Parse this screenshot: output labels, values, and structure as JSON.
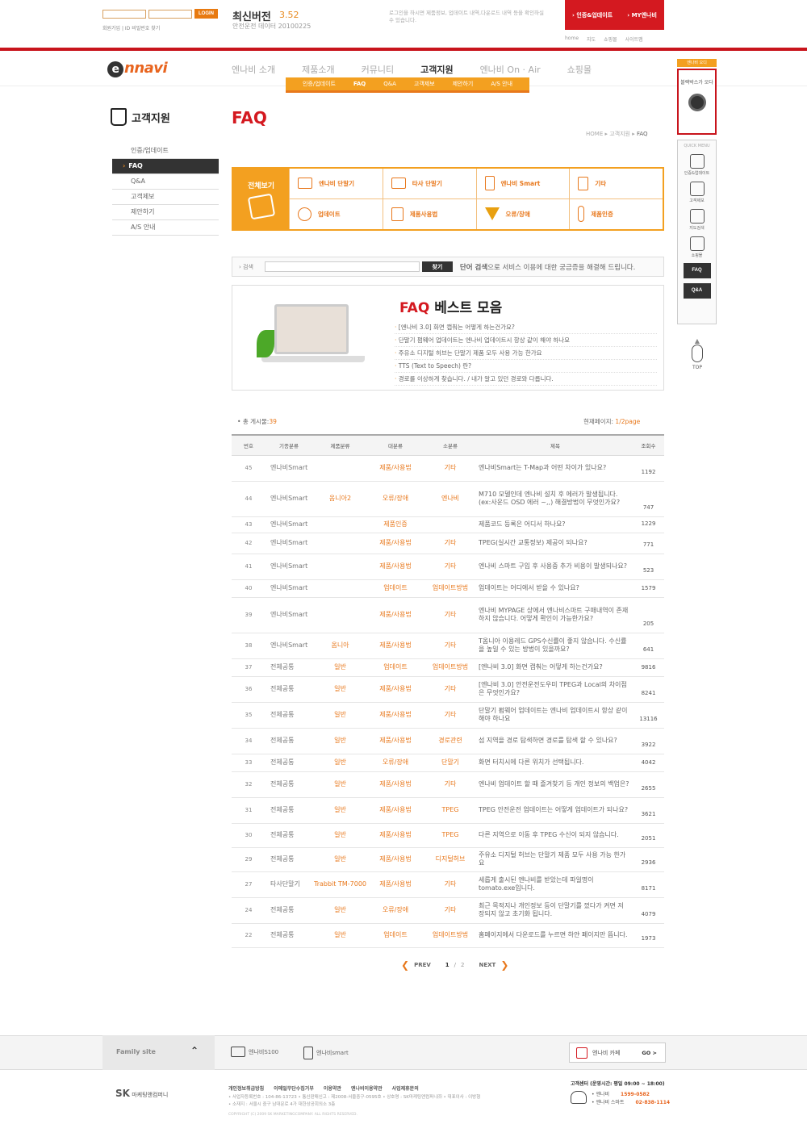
{
  "top": {
    "login_label": "LOGIN",
    "links": "회원가입 | ID 비밀번호 찾기",
    "version_title": "최신버전",
    "version_num": "3.52",
    "version_sub": "안전운전 데이터  20100225",
    "notice": "로그인을 하시면 제품정보, 업데이트 내역,다운로드 내역 등을 확인하실 수 있습니다.",
    "red_links": [
      "인증&업데이트",
      "MY엔나비"
    ],
    "util_links": [
      "home",
      "지도",
      "쇼핑몰",
      "사이트맵"
    ]
  },
  "gnb": {
    "logo_o": "e",
    "logo_text": "nnavi",
    "items": [
      "엔나비 소개",
      "제품소개",
      "커뮤니티",
      "고객지원",
      "엔나비 On · Air",
      "쇼핑몰"
    ],
    "sub": [
      "인증/업데이트",
      "FAQ",
      "Q&A",
      "고객제보",
      "제안하기",
      "A/S 안내"
    ]
  },
  "lnb": {
    "title": "고객지원",
    "items": [
      "인증/업데이트",
      "FAQ",
      "Q&A",
      "고객제보",
      "제안하기",
      "A/S 안내"
    ]
  },
  "page": {
    "title": "FAQ",
    "breadcrumb": [
      "HOME",
      "고객지원",
      "FAQ"
    ]
  },
  "categories": {
    "all": "전체보기",
    "items": [
      "엔나비 단말기",
      "타사 단말기",
      "엔나비 Smart",
      "기타",
      "업데이트",
      "제품사용법",
      "오류/장애",
      "제품인증"
    ]
  },
  "search": {
    "label": "검색",
    "button": "찾기",
    "desc_bold": "단어 검색",
    "desc": "으로 서비스 이용에 대한 궁금증을 해결해 드립니다."
  },
  "best": {
    "title_red": "FAQ",
    "title": " 베스트 모음",
    "items": [
      "[엔나비 3.0] 화면 캡춰는 어떻게 하는건가요?",
      "단말기 펌웨어 업데이트는 엔나비 업데이트시 항상 같이 해야 하나요",
      "주유소 디지털 허브는 단말기 제품 모두 사용 가능 한가요",
      "TTS (Text to Speech) 란?",
      "경로를 이상하게 찾습니다. / 내가 알고 있던 경로와 다릅니다."
    ]
  },
  "list": {
    "total_label": "총 게시물:",
    "total": "39",
    "page_label": "현재페이지:",
    "page": "1/2page",
    "headers": [
      "번호",
      "기종분류",
      "제품분류",
      "대분류",
      "소분류",
      "제목",
      "조회수"
    ],
    "rows": [
      {
        "no": "45",
        "model": "엔나비Smart",
        "product": "",
        "major": "제품/사용법",
        "minor": "기타",
        "title": "엔나비Smart는 T-Map과 어떤 차이가 있나요?",
        "hits": "1192"
      },
      {
        "no": "44",
        "model": "엔나비Smart",
        "product": "옴니아2",
        "major": "오류/장애",
        "minor": "엔나비",
        "title": "M710 모델인데 엔나비 설치 후 에러가 발생됩니다.(ex:사운드 OSD 에러 ~,,) 해결방법이 무엇인가요?",
        "hits": "747"
      },
      {
        "no": "43",
        "model": "엔나비Smart",
        "product": "",
        "major": "제품인증",
        "minor": "",
        "title": "제품코드 등록은 어디서 하나요?",
        "hits": "1229"
      },
      {
        "no": "42",
        "model": "엔나비Smart",
        "product": "",
        "major": "제품/사용법",
        "minor": "기타",
        "title": "TPEG(실시간 교통정보) 제공이 되나요?",
        "hits": "771"
      },
      {
        "no": "41",
        "model": "엔나비Smart",
        "product": "",
        "major": "제품/사용법",
        "minor": "기타",
        "title": "엔나비 스마트 구입 후 사용중 추가 비용이 발생되나요?",
        "hits": "523"
      },
      {
        "no": "40",
        "model": "엔나비Smart",
        "product": "",
        "major": "업데이트",
        "minor": "업데이트방법",
        "title": "업데이트는 어디에서 받을 수 있나요?",
        "hits": "1579"
      },
      {
        "no": "39",
        "model": "엔나비Smart",
        "product": "",
        "major": "제품/사용법",
        "minor": "기타",
        "title": "엔나비 MYPAGE 상에서 엔나비스마트 구매내역이 존재하지 않습니다. 어떻게 확인이 가능한가요?",
        "hits": "205"
      },
      {
        "no": "38",
        "model": "엔나비Smart",
        "product": "옴니아",
        "major": "제품/사용법",
        "minor": "기타",
        "title": "T옴니아 이용레드 GPS수신률이 좋지 않습니다. 수신률을 높일 수 있는 방법이 있을까요?",
        "hits": "641"
      },
      {
        "no": "37",
        "model": "전체공통",
        "product": "일반",
        "major": "업데이트",
        "minor": "업데이트방법",
        "title": "[엔나비 3.0] 화면 캡춰는 어떻게 하는건가요?",
        "hits": "9816"
      },
      {
        "no": "36",
        "model": "전체공통",
        "product": "일반",
        "major": "제품/사용법",
        "minor": "기타",
        "title": "[엔나비 3.0] 안전운전도우미 TPEG과 Local의 차이점은 무엇인가요?",
        "hits": "8241"
      },
      {
        "no": "35",
        "model": "전체공통",
        "product": "일반",
        "major": "제품/사용법",
        "minor": "기타",
        "title": "단말기 펌웨어 업데이트는 엔나비 업데이트시 항상 같이 해야 하나요",
        "hits": "13116"
      },
      {
        "no": "34",
        "model": "전체공통",
        "product": "일반",
        "major": "제품/사용법",
        "minor": "경로관련",
        "title": "섬 지역을 경로 탐색하면 경로를 탐색 할 수 있나요?",
        "hits": "3922"
      },
      {
        "no": "33",
        "model": "전체공통",
        "product": "일반",
        "major": "오류/장애",
        "minor": "단말기",
        "title": "화면 터치시에 다른 위치가 선택됩니다.",
        "hits": "4042"
      },
      {
        "no": "32",
        "model": "전체공통",
        "product": "일반",
        "major": "제품/사용법",
        "minor": "기타",
        "title": "엔나비 업데이트 할 때 즐겨찾기 등 개인 정보의 백업은?",
        "hits": "2655"
      },
      {
        "no": "31",
        "model": "전체공통",
        "product": "일반",
        "major": "제품/사용법",
        "minor": "TPEG",
        "title": "TPEG 안전운전 업데이트는 어떻게 업데이트가 되나요?",
        "hits": "3621"
      },
      {
        "no": "30",
        "model": "전체공통",
        "product": "일반",
        "major": "제품/사용법",
        "minor": "TPEG",
        "title": "다른 지역으로 이동 후 TPEG 수신이 되지 않습니다.",
        "hits": "2051"
      },
      {
        "no": "29",
        "model": "전체공통",
        "product": "일반",
        "major": "제품/사용법",
        "minor": "디지털허브",
        "title": "주유소 디지털 허브는 단말기 제품 모두 사용 가능 한가요",
        "hits": "2936"
      },
      {
        "no": "27",
        "model": "타사단말기",
        "product": "Trabbit TM-7000",
        "major": "제품/사용법",
        "minor": "기타",
        "title": "세롭게 출시된 엔나비를 받았는데 파일명이 tomato.exe입니다.",
        "hits": "8171"
      },
      {
        "no": "24",
        "model": "전체공통",
        "product": "일반",
        "major": "오류/장애",
        "minor": "기타",
        "title": "최근 목적지나 개인정보 등이 단말기를 껐다가 켜면 저장되지 않고 초기화 됩니다.",
        "hits": "4079"
      },
      {
        "no": "22",
        "model": "전체공통",
        "product": "일반",
        "major": "업데이트",
        "minor": "업데이트방법",
        "title": "홈페이지에서 다운로드를 누르면 하얀 페이지만 뜹니다.",
        "hits": "1973"
      }
    ]
  },
  "pager": {
    "prev": "PREV",
    "pages": [
      "1",
      "2"
    ],
    "next": "NEXT"
  },
  "quick": {
    "tag": "엔나비 오디",
    "ad_text": "블랙박스가 오다",
    "header": "QUICK MENU",
    "items": [
      "인증&업데이트",
      "고객제보",
      "지도검색",
      "쇼핑몰"
    ],
    "faq": "FAQ",
    "qna": "Q&A",
    "top": "TOP"
  },
  "footer": {
    "family": "Family site",
    "family_links": [
      "엔나비S100",
      "엔나비smart"
    ],
    "cafe": "엔나비 카페",
    "go": "GO >",
    "sk_logo": "SK",
    "sk_text": "마케팅앤컴퍼니",
    "links": [
      "개인정보취급방침",
      "이메일무단수집거부",
      "이용약관",
      "엔나비이용약관",
      "사업제휴문의"
    ],
    "info1": "• 사업자등록번호 : 104-86-13723 • 통신판매신고 : 제2008-서울중구-0595호 • 상호명 : SK마케팅앤컴퍼니㈜ • 대표이사 : 이방형",
    "info2": "• 소재지 : 서울시 중구 남대문로 4가 대한상공회의소 3층",
    "copyright": "COPYRIGHT (C) 2009 SK MARKETINGCOMPANY. ALL RIGHTS RESERVED.",
    "cs_title": "고객센터 (운영시간:",
    "cs_hours": "평일 09:00 ~ 18:00)",
    "cs_rows": [
      {
        "label": "• 엔나비",
        "num": "1599-0582"
      },
      {
        "label": "• 엔나비 스마트",
        "num": "02-838-1114"
      }
    ]
  }
}
